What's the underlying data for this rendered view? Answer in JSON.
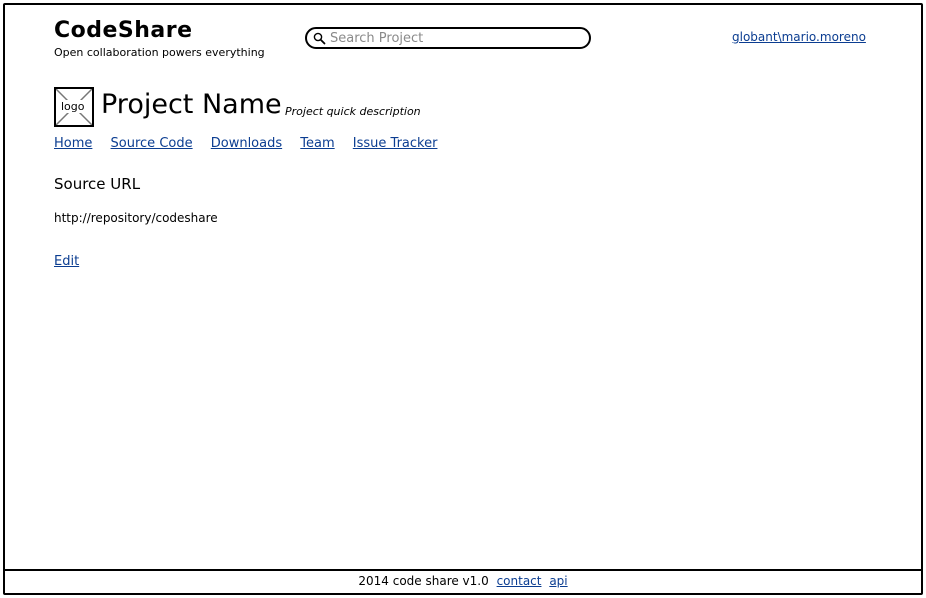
{
  "header": {
    "brand_title": "CodeShare",
    "tagline": "Open collaboration powers everything",
    "search_placeholder": "Search Project",
    "search_value": "",
    "user": "globant\\mario.moreno"
  },
  "project": {
    "logo_label": "logo",
    "name": "Project Name",
    "description": "Project quick description"
  },
  "nav": {
    "items": [
      {
        "label": "Home"
      },
      {
        "label": "Source Code"
      },
      {
        "label": "Downloads"
      },
      {
        "label": "Team"
      },
      {
        "label": "Issue Tracker"
      }
    ]
  },
  "content": {
    "section_title": "Source URL",
    "source_url": "http://repository/codeshare",
    "edit_label": "Edit"
  },
  "footer": {
    "text": "2014 code share v1.0",
    "links": [
      {
        "label": "contact"
      },
      {
        "label": "api"
      }
    ]
  },
  "colors": {
    "link": "#0b3d91",
    "border": "#000000",
    "background": "#ffffff"
  },
  "icons": {
    "search": "search-icon"
  }
}
